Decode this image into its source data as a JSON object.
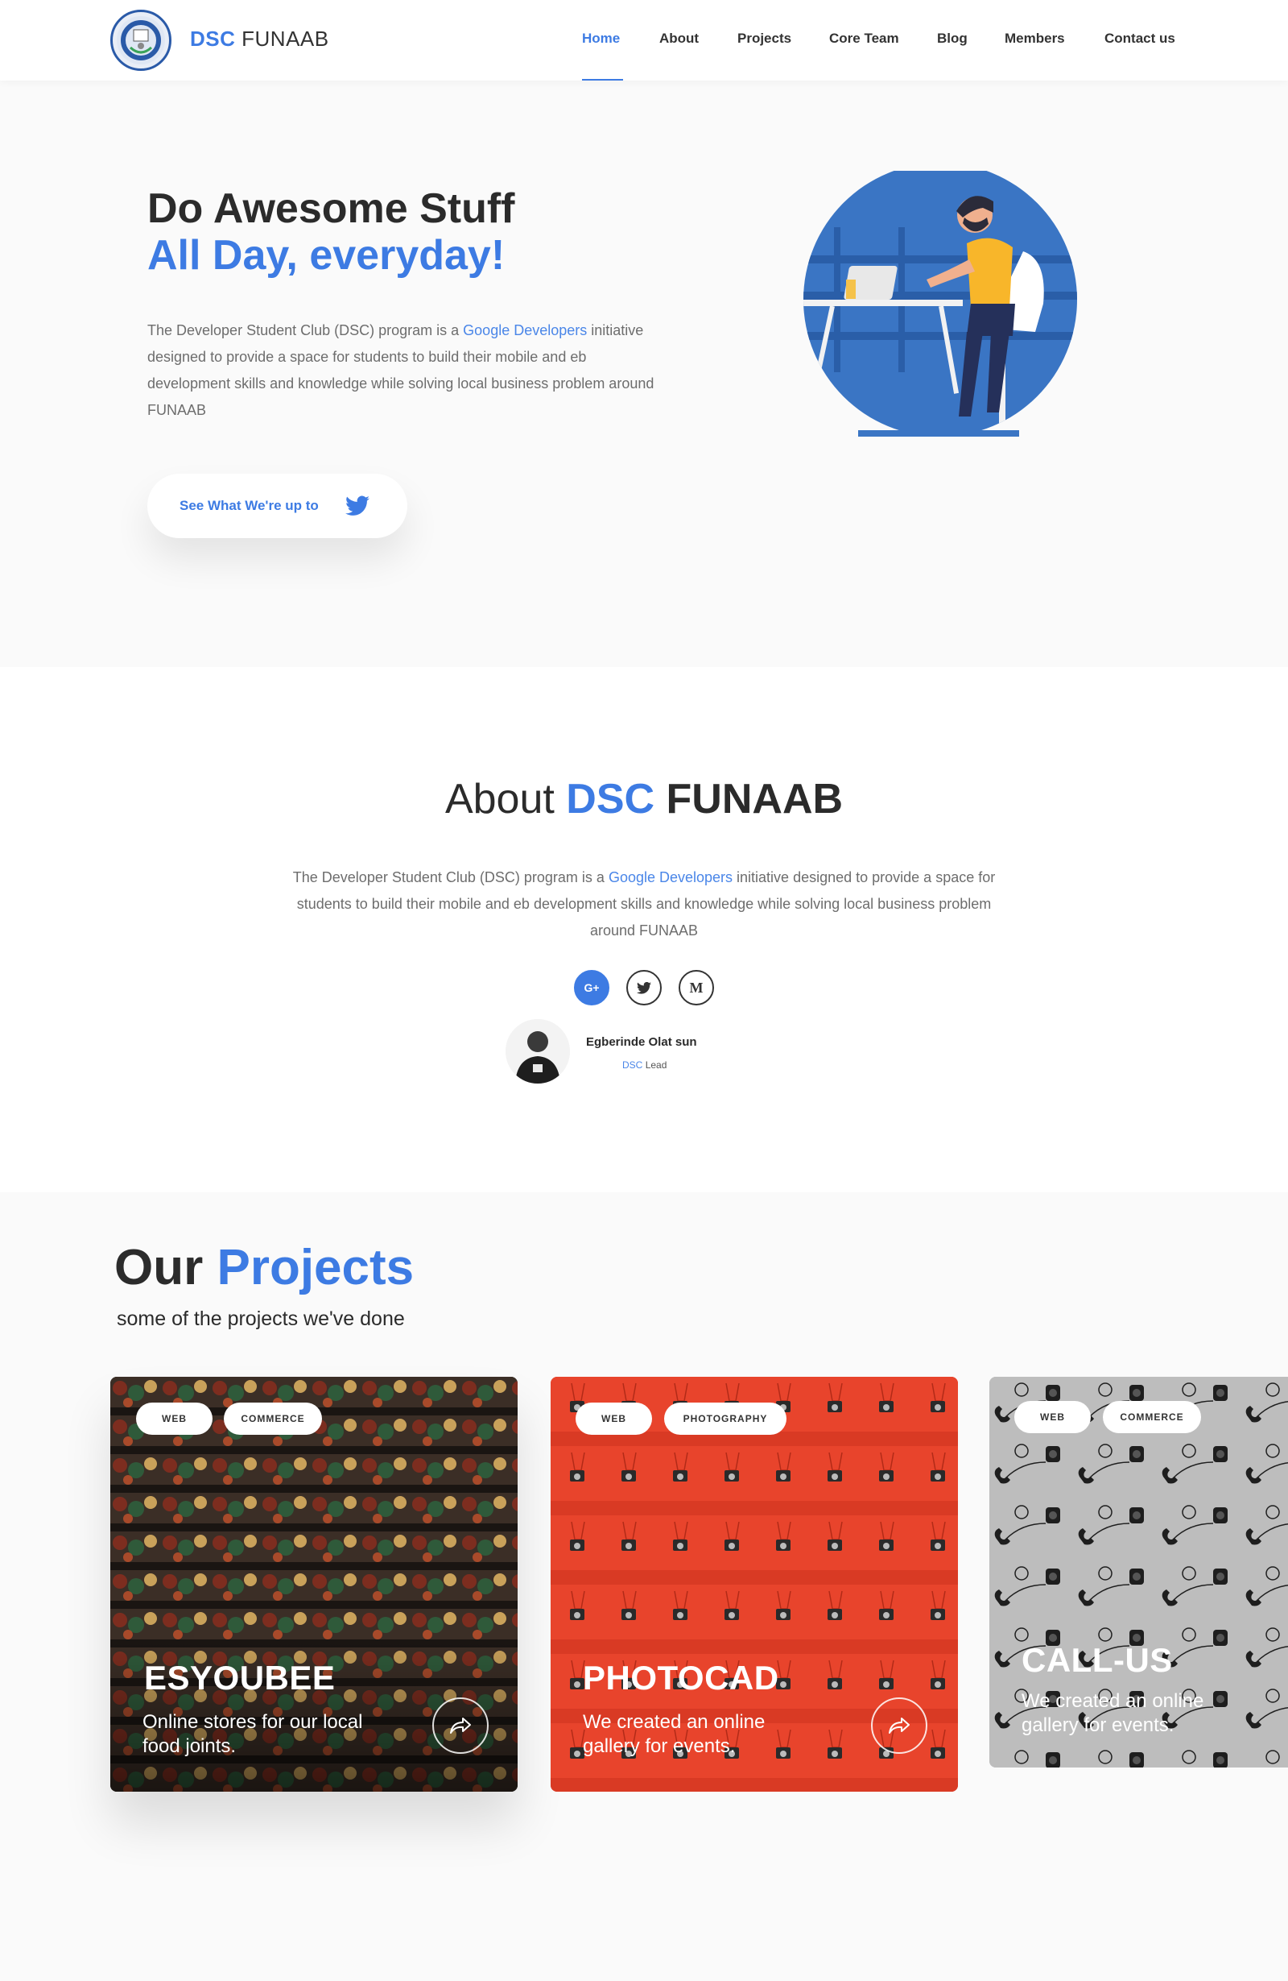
{
  "brand": {
    "name_bold": "DSC",
    "name_rest": "FUNAAB"
  },
  "nav": {
    "items": [
      "Home",
      "About",
      "Projects",
      "Core Team",
      "Blog",
      "Members",
      "Contact us"
    ],
    "active": "Home"
  },
  "hero": {
    "title_line1": "Do Awesome Stuff",
    "title_line2": "All Day, everyday!",
    "desc_before": "The Developer Student Club (DSC) program is a ",
    "desc_link": "Google Developers",
    "desc_after": " initiative designed to provide a space for students to build their mobile and eb development skills and knowledge while solving local business problem around FUNAAB",
    "cta_label": "See What We're up to"
  },
  "about": {
    "title_prefix": "About",
    "title_accent": "DSC",
    "title_suffix": "FUNAAB",
    "desc_before": "The Developer Student Club (DSC) program is a ",
    "desc_link": "Google Developers",
    "desc_after": " initiative designed to provide a space for students to build their mobile and eb development skills and knowledge while solving local business problem around FUNAAB",
    "social": [
      {
        "icon": "google-plus-icon",
        "glyph": "G+"
      },
      {
        "icon": "twitter-icon",
        "glyph": ""
      },
      {
        "icon": "medium-icon",
        "glyph": "M"
      }
    ],
    "lead_name": "Egberinde Olat sun",
    "lead_role_accent": "DSC",
    "lead_role_rest": "Lead"
  },
  "projects": {
    "title_prefix": "Our",
    "title_accent": "Projects",
    "subtitle": "some of the projects we've done",
    "cards": [
      {
        "tags": [
          "WEB",
          "COMMERCE"
        ],
        "title": "ESYOUBEE",
        "desc": "Online stores for our local food joints."
      },
      {
        "tags": [
          "WEB",
          "PHOTOGRAPHY"
        ],
        "title": "PHOTOCAD",
        "desc": "We created an online gallery for events."
      },
      {
        "tags": [
          "WEB",
          "COMMERCE"
        ],
        "title": "CALL-US",
        "desc": "We created an online gallery for events."
      }
    ]
  },
  "colors": {
    "accent": "#3d7be3",
    "text": "#2b2b2b",
    "muted": "#6d6d6d",
    "card_red": "#e8442c",
    "card_gray": "#b9b9b9"
  }
}
